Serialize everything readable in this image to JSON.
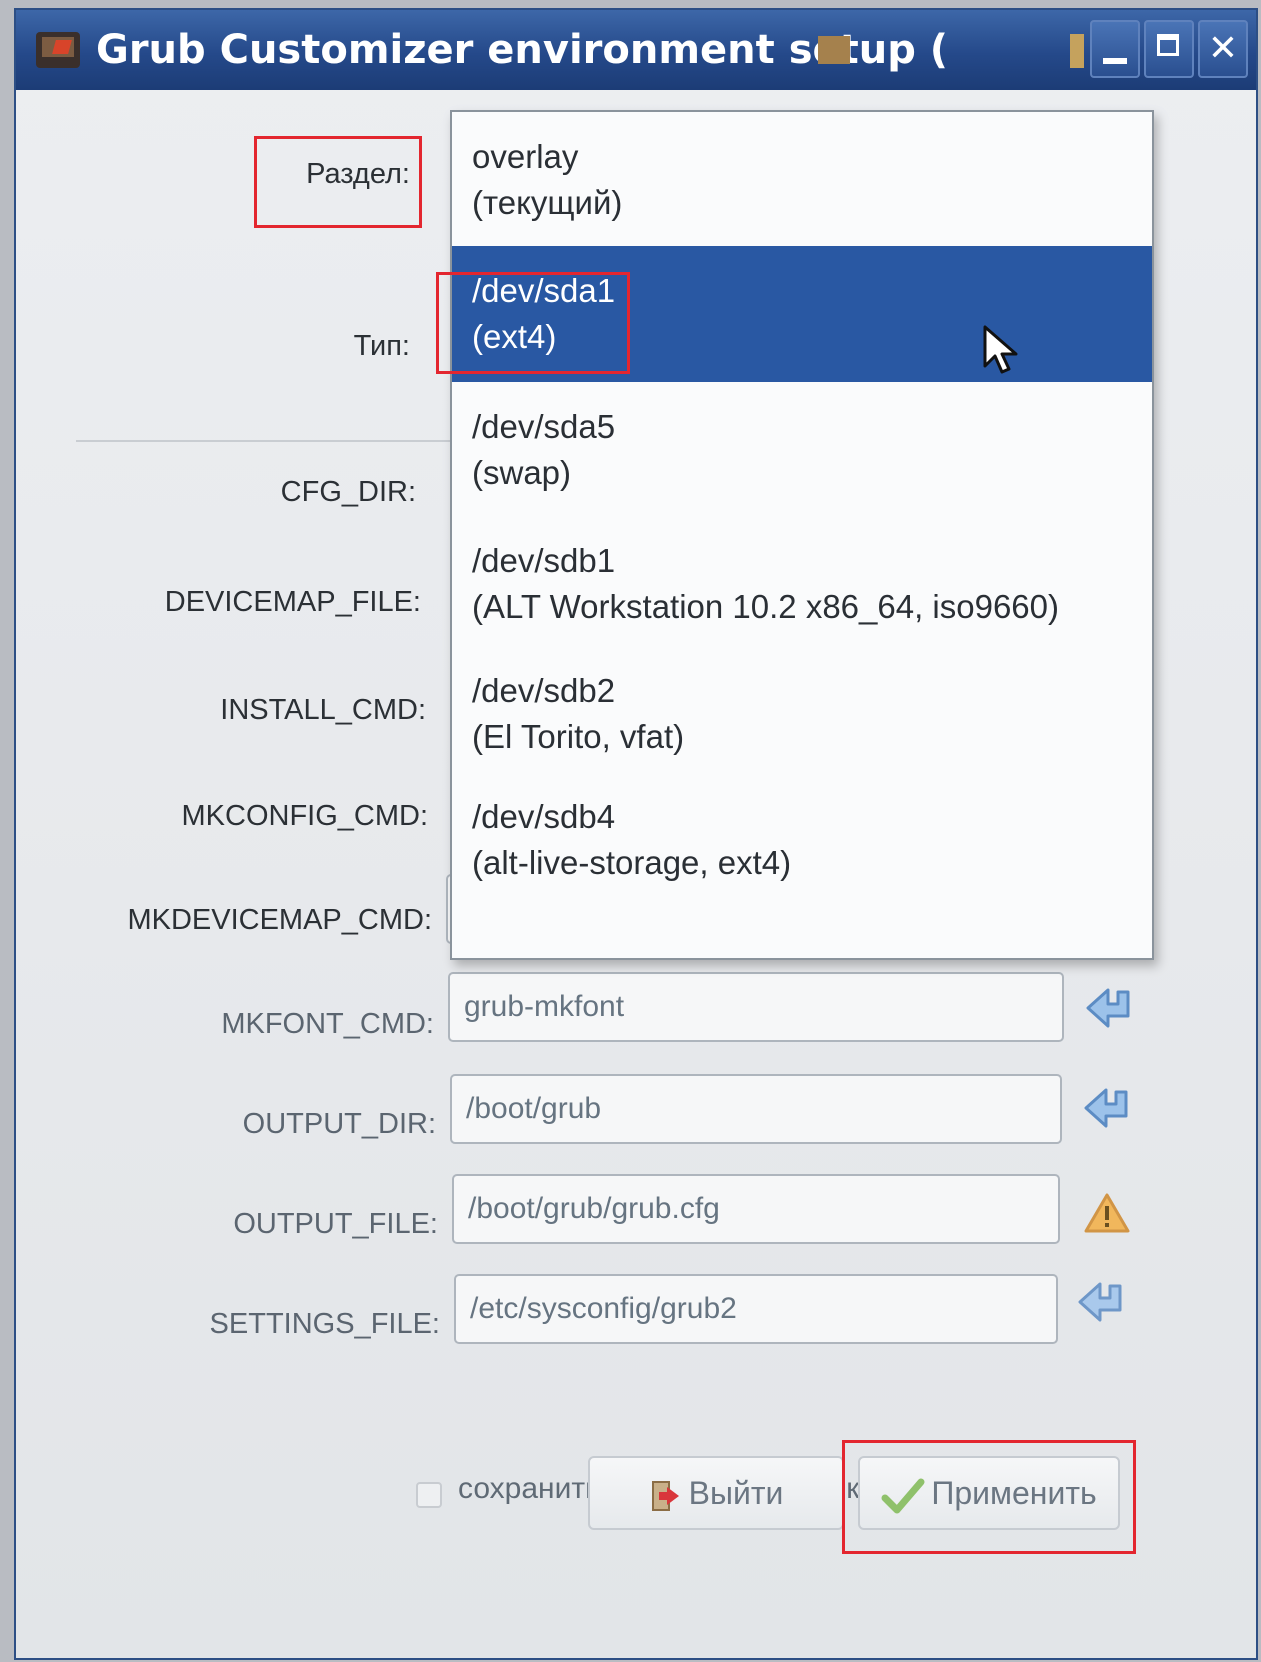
{
  "window": {
    "title": "Grub Customizer environment setup (",
    "close_glyph": "✕"
  },
  "form": {
    "partition_label": "Раздел:",
    "type_label": "Тип:",
    "fields": [
      {
        "label": "CFG_DIR:",
        "value": "",
        "status": "revert-icon"
      },
      {
        "label": "DEVICEMAP_FILE:",
        "value": "",
        "status": "warning-icon"
      },
      {
        "label": "INSTALL_CMD:",
        "value": "",
        "status": "revert-icon"
      },
      {
        "label": "MKCONFIG_CMD:",
        "value": "",
        "status": "revert-icon"
      },
      {
        "label": "MKDEVICEMAP_CMD:",
        "value": "",
        "status": "warning-icon"
      },
      {
        "label": "MKFONT_CMD:",
        "value": "grub-mkfont",
        "status": "revert-icon"
      },
      {
        "label": "OUTPUT_DIR:",
        "value": "/boot/grub",
        "status": "revert-icon"
      },
      {
        "label": "OUTPUT_FILE:",
        "value": "/boot/grub/grub.cfg",
        "status": "warning-icon"
      },
      {
        "label": "SETTINGS_FILE:",
        "value": "/etc/sysconfig/grub2",
        "status": "revert-icon"
      }
    ],
    "keep_settings_label": "сохранить текущие настройки",
    "keep_settings_checked": false
  },
  "partition_dropdown": {
    "selected_index": 1,
    "options": [
      {
        "device": "overlay",
        "detail": "(текущий)"
      },
      {
        "device": "/dev/sda1",
        "detail": "(ext4)"
      },
      {
        "device": "/dev/sda5",
        "detail": "(swap)"
      },
      {
        "device": "/dev/sdb1",
        "detail": "(ALT Workstation 10.2 x86_64, iso9660)"
      },
      {
        "device": "/dev/sdb2",
        "detail": "(El Torito, vfat)"
      },
      {
        "device": "/dev/sdb4",
        "detail": "(alt-live-storage, ext4)"
      }
    ]
  },
  "buttons": {
    "exit_label": "Выйти",
    "apply_label": "Применить"
  },
  "colors": {
    "titlebar": "#25498a",
    "selection": "#2958a3",
    "highlight_box": "#e3262f"
  }
}
